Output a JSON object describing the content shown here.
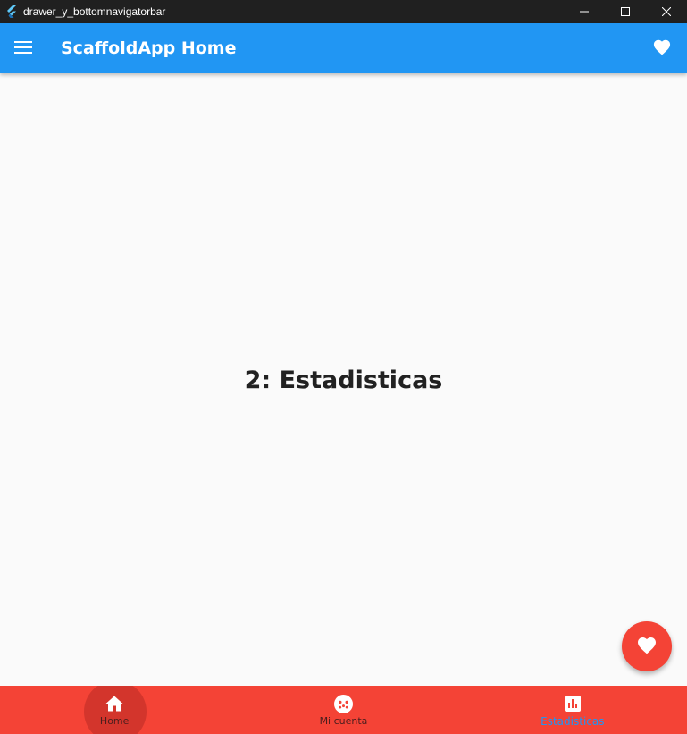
{
  "window": {
    "title": "drawer_y_bottomnavigatorbar"
  },
  "appbar": {
    "title": "ScaffoldApp Home",
    "menu_icon": "menu-icon",
    "action_icon": "favorite-icon"
  },
  "body": {
    "text": "2: Estadisticas"
  },
  "fab": {
    "icon": "favorite-icon"
  },
  "bottom_nav": {
    "items": [
      {
        "label": "Home",
        "icon": "home-icon"
      },
      {
        "label": "Mi cuenta",
        "icon": "face-icon"
      },
      {
        "label": "Estadisticas",
        "icon": "bar-chart-icon"
      }
    ],
    "selected_index": 2
  },
  "colors": {
    "appbar": "#2196f3",
    "nav_background": "#f44336",
    "fab": "#f44336",
    "selected_label": "#2196f3"
  }
}
